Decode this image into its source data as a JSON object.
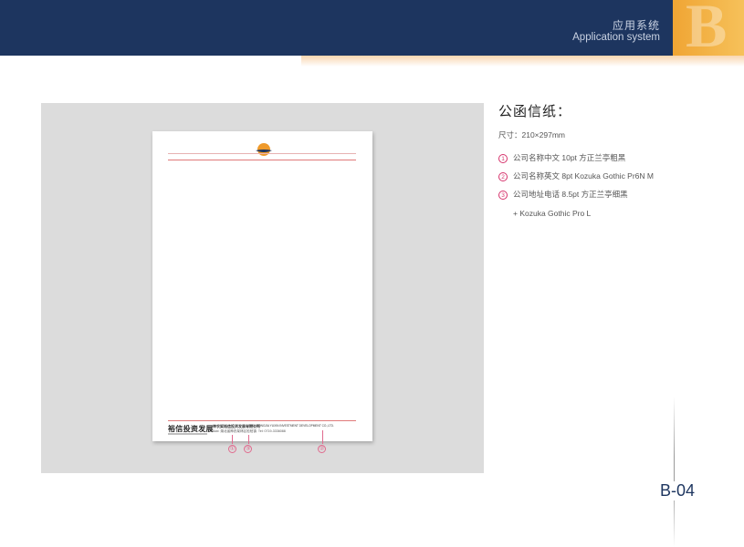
{
  "header": {
    "title_cn": "应用系统",
    "title_en": "Application system",
    "section_letter": "B",
    "band_color": "#1d355f",
    "accent_color": "#f0a534"
  },
  "mockup": {
    "footer": {
      "logo_text": "裕信投资发展",
      "company_cn": "神农架裕信投资发展有限公司",
      "company_en": "SHENNONGJIA YUXIN INVESTMENT DEVELOPMENT CO.,LTD.",
      "address": "Add: 湖北省神农架林区松柏镇",
      "tel": "Tel: 0719-3336088"
    },
    "callouts": [
      "①",
      "③",
      "②"
    ]
  },
  "spec": {
    "title": "公函信纸：",
    "size": "尺寸：210×297mm",
    "items": [
      {
        "num": "1",
        "text": "公司名称中文 10pt 方正兰亭粗黑"
      },
      {
        "num": "2",
        "text": "公司名称英文 8pt Kozuka Gothic Pr6N M"
      },
      {
        "num": "3",
        "text": "公司地址电话 8.5pt 方正兰亭细黑"
      }
    ],
    "continuation": "+ Kozuka Gothic Pro L"
  },
  "page_number": "B-04"
}
